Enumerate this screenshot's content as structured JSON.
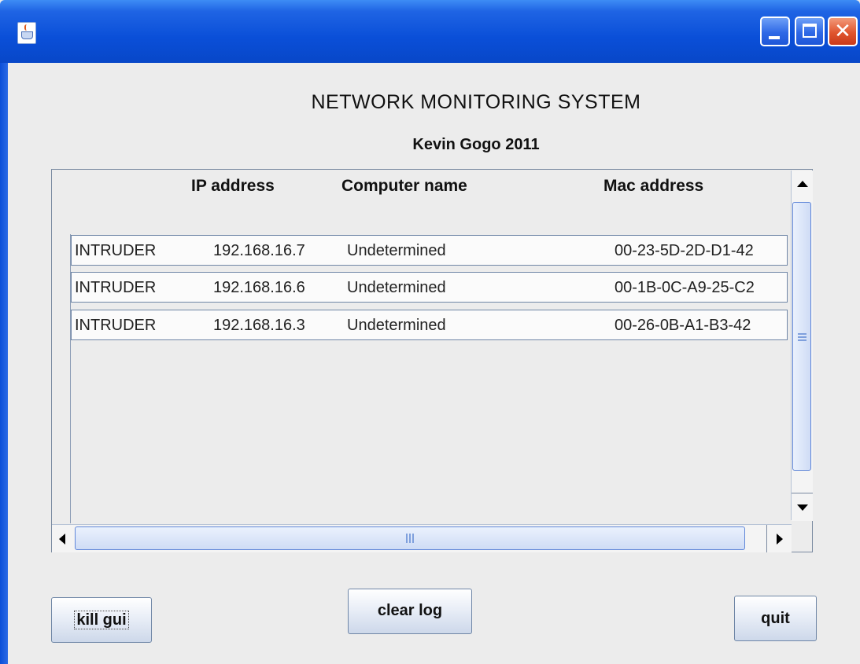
{
  "window": {
    "title_bar_buttons": [
      "minimize",
      "maximize",
      "close"
    ],
    "icon": "java-cup-icon"
  },
  "header": {
    "title": "NETWORK MONITORING SYSTEM",
    "subtitle": "Kevin Gogo 2011"
  },
  "table": {
    "columns": [
      "IP address",
      "Computer name",
      "Mac address"
    ],
    "rows": [
      {
        "status": "INTRUDER",
        "ip": "192.168.16.7",
        "name": "Undetermined",
        "mac": "00-23-5D-2D-D1-42"
      },
      {
        "status": "INTRUDER",
        "ip": "192.168.16.6",
        "name": "Undetermined",
        "mac": "00-1B-0C-A9-25-C2"
      },
      {
        "status": "INTRUDER",
        "ip": "192.168.16.3",
        "name": "Undetermined",
        "mac": "00-26-0B-A1-B3-42"
      }
    ]
  },
  "buttons": {
    "kill": "kill gui",
    "clear": "clear log",
    "quit": "quit"
  },
  "colors": {
    "titlebar": "#0a4fd8",
    "close": "#e0552e",
    "background": "#ececec"
  }
}
